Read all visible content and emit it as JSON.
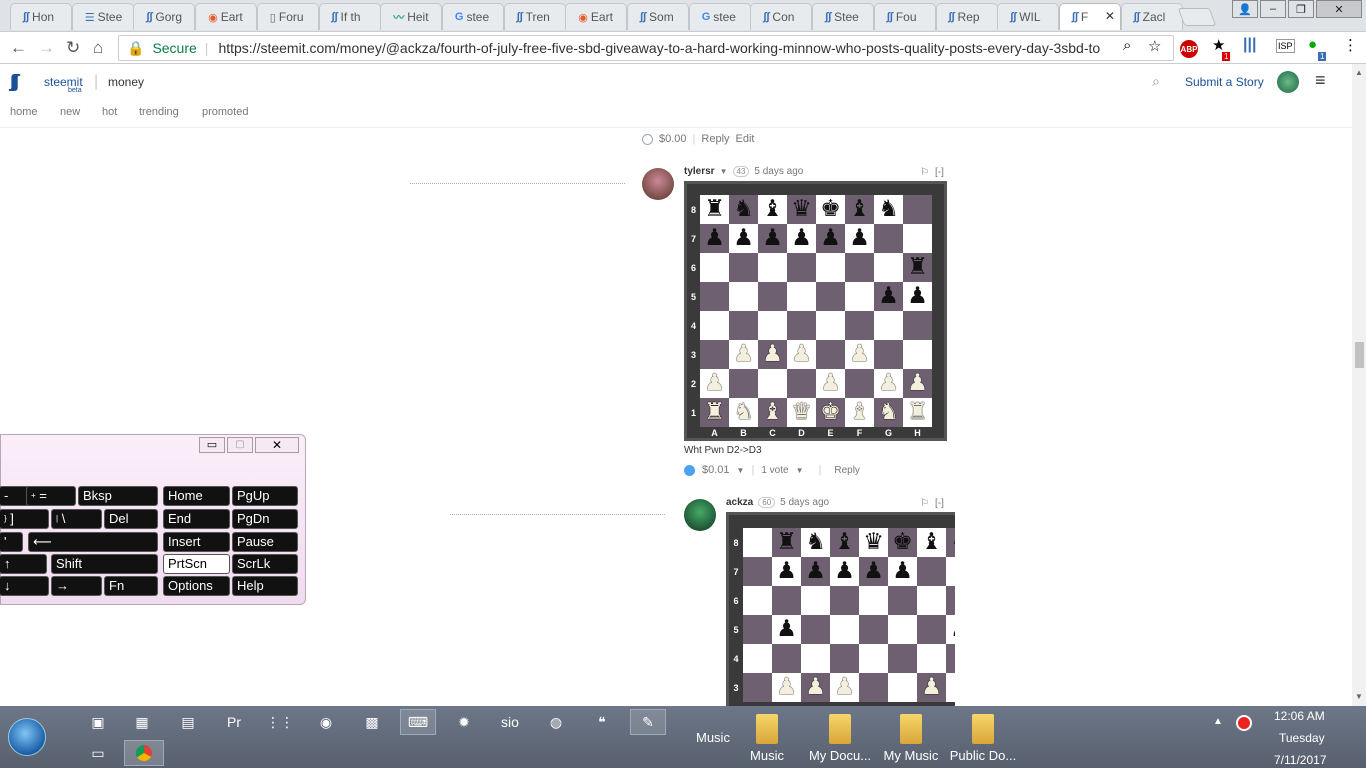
{
  "browser": {
    "tabs": [
      {
        "label": "Hon",
        "icon": "steemit-icon"
      },
      {
        "label": "Stee",
        "icon": "list-icon"
      },
      {
        "label": "Gorg",
        "icon": "steemit-icon"
      },
      {
        "label": "Eart",
        "icon": "reddit-icon"
      },
      {
        "label": "Foru",
        "icon": "document-icon"
      },
      {
        "label": "If th",
        "icon": "steemit-icon"
      },
      {
        "label": "Heit",
        "icon": "trend-icon"
      },
      {
        "label": "stee",
        "icon": "google-icon"
      },
      {
        "label": "Tren",
        "icon": "steemit-icon"
      },
      {
        "label": "Eart",
        "icon": "reddit-icon"
      },
      {
        "label": "Som",
        "icon": "steemit-icon"
      },
      {
        "label": "stee",
        "icon": "google-icon"
      },
      {
        "label": "Con",
        "icon": "steemit-icon"
      },
      {
        "label": "Stee",
        "icon": "steemit-icon"
      },
      {
        "label": "Fou",
        "icon": "steemit-icon"
      },
      {
        "label": "Rep",
        "icon": "steemit-icon"
      },
      {
        "label": "WIL",
        "icon": "steemit-icon"
      },
      {
        "label": "F",
        "icon": "steemit-icon",
        "active": true
      },
      {
        "label": "Zacl",
        "icon": "steemit-icon"
      }
    ],
    "secure_label": "Secure",
    "url": "https://steemit.com/money/@ackza/fourth-of-july-free-five-sbd-giveaway-to-a-hard-working-minnow-who-posts-quality-posts-every-day-3sbd-to",
    "extension_badge": "1",
    "extension_badge2": "1"
  },
  "site": {
    "logo_text": "steemit",
    "logo_sub": "beta",
    "category": "money",
    "submit_label": "Submit a Story",
    "nav": [
      "home",
      "new",
      "hot",
      "trending",
      "promoted"
    ]
  },
  "top_comment_actions": {
    "payout": "$0.00",
    "reply": "Reply",
    "edit": "Edit"
  },
  "comments": [
    {
      "author": "tylersr",
      "rep": "43",
      "time": "5 days ago",
      "flag": "[-]",
      "text": "Wht Pwn D2->D3",
      "payout": "$0.01",
      "votes": "1 vote",
      "reply": "Reply"
    },
    {
      "author": "ackza",
      "rep": "60",
      "time": "5 days ago",
      "flag": "[-]"
    }
  ],
  "board1": {
    "ranks": [
      "8",
      "7",
      "6",
      "5",
      "4",
      "3",
      "2",
      "1"
    ],
    "files": [
      "A",
      "B",
      "C",
      "D",
      "E",
      "F",
      "G",
      "H"
    ],
    "position": [
      "rnbqkbn.",
      "pppppp..",
      ".......r",
      "......pp",
      "........",
      ".PPP.P..",
      "P...P.PP",
      "RNBQKBNR"
    ]
  },
  "board2": {
    "ranks": [
      "8",
      "7",
      "6",
      "5",
      "4",
      "3"
    ],
    "position": [
      ".rnbqkbn",
      ".ppppp..",
      "........",
      ".p.....p",
      "........",
      ".PPP..P."
    ]
  },
  "osk": {
    "keys": [
      {
        "label": "-",
        "sub": ""
      },
      {
        "label": "=",
        "sub": "+"
      },
      {
        "label": "Bksp",
        "sub": ""
      },
      {
        "label": "Home",
        "sub": ""
      },
      {
        "label": "PgUp",
        "sub": ""
      },
      {
        "label": "]",
        "sub": "}"
      },
      {
        "label": "\\",
        "sub": "|"
      },
      {
        "label": "Del",
        "sub": ""
      },
      {
        "label": "End",
        "sub": ""
      },
      {
        "label": "PgDn",
        "sub": ""
      },
      {
        "label": "'",
        "sub": ""
      },
      {
        "label": "⟵",
        "sub": ""
      },
      {
        "label": "Insert",
        "sub": ""
      },
      {
        "label": "Pause",
        "sub": ""
      },
      {
        "label": "↑",
        "sub": ""
      },
      {
        "label": "Shift",
        "sub": ""
      },
      {
        "label": "PrtScn",
        "sub": ""
      },
      {
        "label": "ScrLk",
        "sub": ""
      },
      {
        "label": "↓",
        "sub": ""
      },
      {
        "label": "→",
        "sub": ""
      },
      {
        "label": "Fn",
        "sub": ""
      },
      {
        "label": "Options",
        "sub": ""
      },
      {
        "label": "Help",
        "sub": ""
      }
    ]
  },
  "taskbar": {
    "music_label": "Music",
    "folders": [
      "Music",
      "My Docu...",
      "My Music",
      "Public Do..."
    ],
    "time": "12:06 AM",
    "day": "Tuesday",
    "date": "7/11/2017"
  },
  "colors": {
    "steemit_blue": "#1a5099",
    "secure_green": "#0b8043",
    "light_sq": "#ffffff",
    "dark_sq": "#6e6070"
  }
}
